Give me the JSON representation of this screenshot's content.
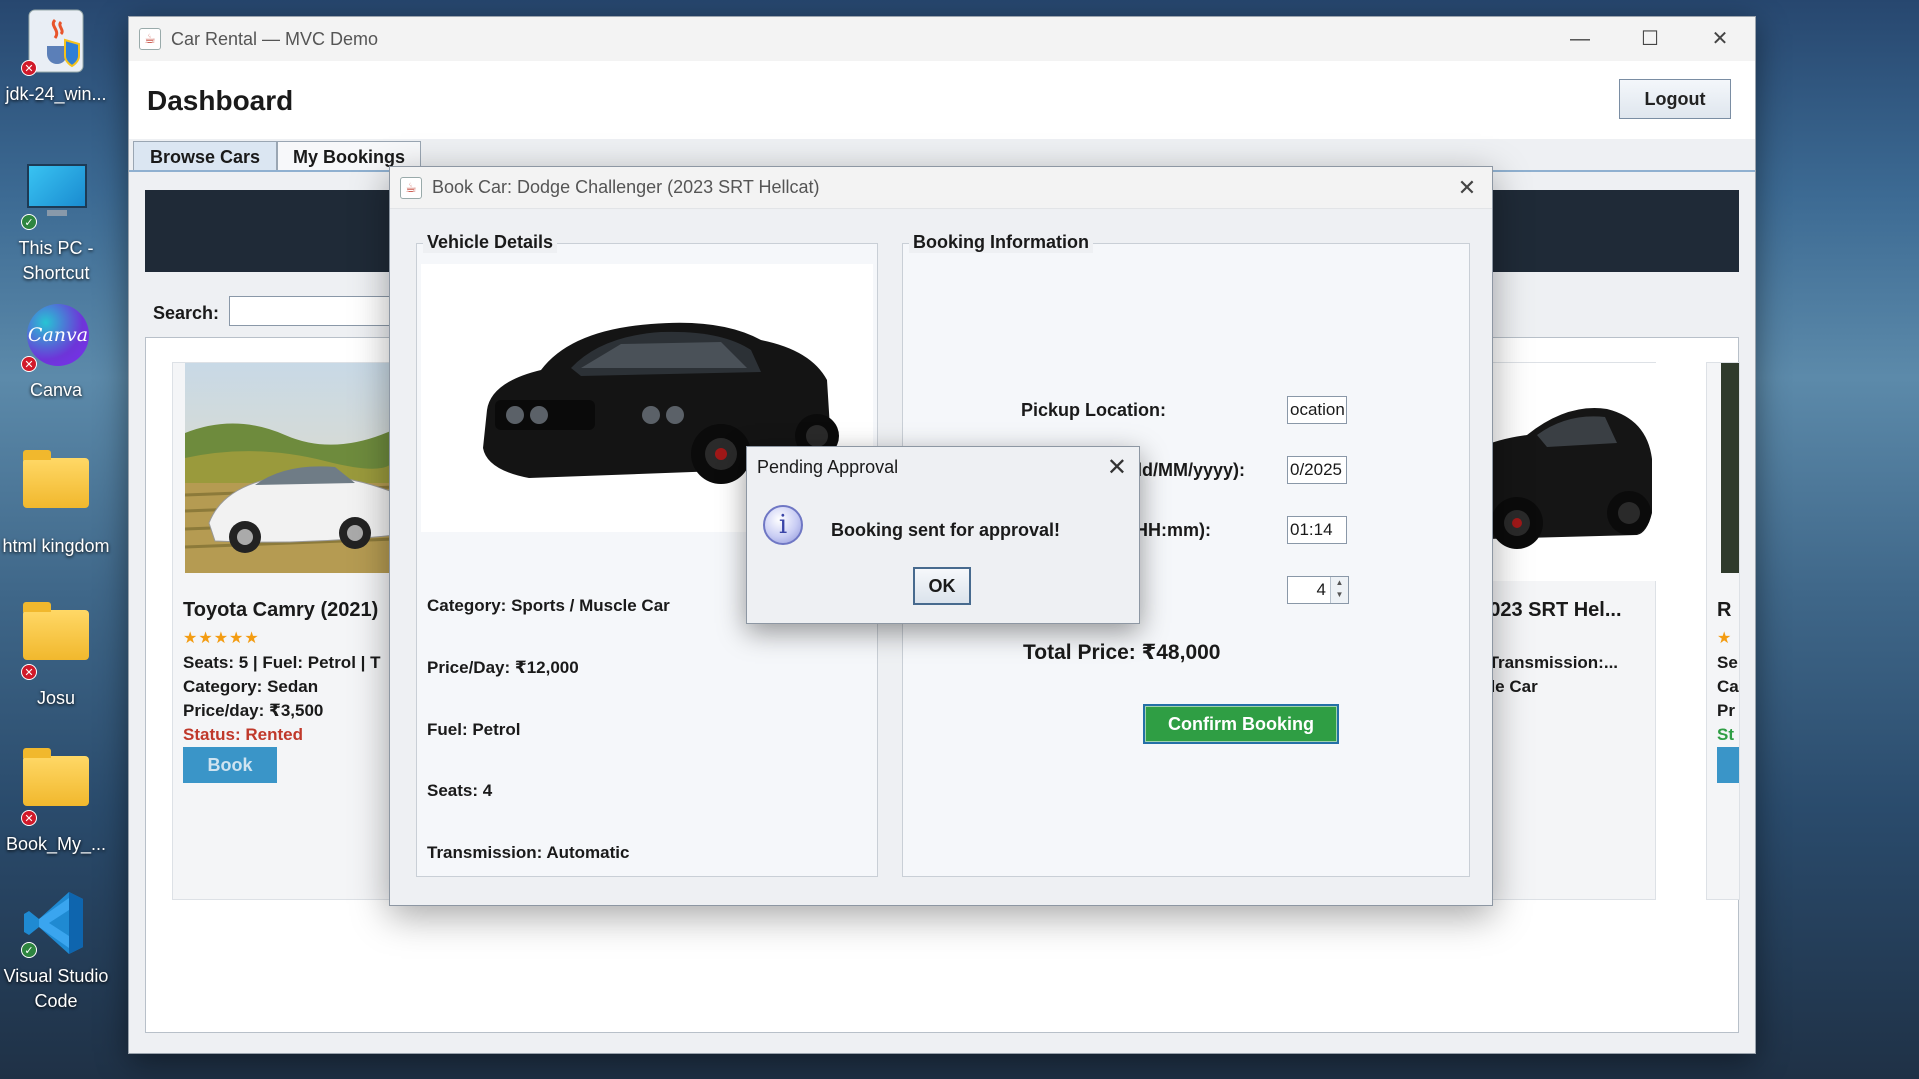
{
  "desktop": {
    "icons": [
      {
        "name": "jdk-icon",
        "label": "jdk-24_win...",
        "badge": "err"
      },
      {
        "name": "this-pc-icon",
        "label": "This PC - Shortcut",
        "badge": "ok"
      },
      {
        "name": "canva-icon",
        "label": "Canva",
        "badge": "err"
      },
      {
        "name": "html-kingdom-folder-icon",
        "label": "html kingdom",
        "badge": ""
      },
      {
        "name": "josu-folder-icon",
        "label": "Josu",
        "badge": "err"
      },
      {
        "name": "book-my-folder-icon",
        "label": "Book_My_...",
        "badge": "err"
      },
      {
        "name": "vscode-icon",
        "label": "Visual Studio Code",
        "badge": "ok"
      }
    ],
    "canva_text": "Canva"
  },
  "window": {
    "title": "Car Rental — MVC Demo",
    "controls": {
      "minimize": "—",
      "maximize": "☐",
      "close": "✕"
    }
  },
  "header": {
    "title": "Dashboard",
    "logout_label": "Logout"
  },
  "tabs": [
    {
      "label": "Browse Cars"
    },
    {
      "label": "My Bookings"
    }
  ],
  "search": {
    "label": "Search:",
    "value": ""
  },
  "cards": {
    "left": {
      "title": "Toyota Camry (2021)",
      "stars": "★★★★★",
      "specs": "Seats: 5 | Fuel: Petrol | T",
      "category": "Category: Sedan",
      "price": "Price/day: ₹3,500",
      "status": "Status: Rented",
      "book_label": "Book"
    },
    "right": {
      "title": "er (2023 SRT Hel...",
      "specs": "trol | Transmission:...",
      "category": "Muscle Car"
    },
    "far_right": {
      "title": "R",
      "stars": "★",
      "line1": "Se",
      "line2": "Ca",
      "line3": "Pr",
      "line4": "St"
    }
  },
  "book_dialog": {
    "title": "Book Car: Dodge Challenger (2023 SRT Hellcat)",
    "close": "✕",
    "vehicle": {
      "legend": "Vehicle Details",
      "category": "Category: Sports / Muscle Car",
      "price": "Price/Day: ₹12,000",
      "fuel": "Fuel: Petrol",
      "seats": "Seats: 4",
      "transmission": "Transmission: Automatic"
    },
    "booking": {
      "legend": "Booking Information",
      "pickup_label": "Pickup Location:",
      "pickup_value": "ocation",
      "date_label": "dd/MM/yyyy):",
      "date_value": "0/2025",
      "time_label": "HH:mm):",
      "time_value": "01:14",
      "days_value": "4",
      "total": "Total Price: ₹48,000",
      "confirm_label": "Confirm Booking"
    }
  },
  "pending_dialog": {
    "title": "Pending Approval",
    "close": "✕",
    "icon_glyph": "i",
    "message": "Booking sent for approval!",
    "ok_label": "OK"
  },
  "colors": {
    "accent_green": "#2f9e44",
    "book_blue": "#3a95c8",
    "status_red": "#c0392b",
    "hero_dark": "#1f2a37"
  }
}
